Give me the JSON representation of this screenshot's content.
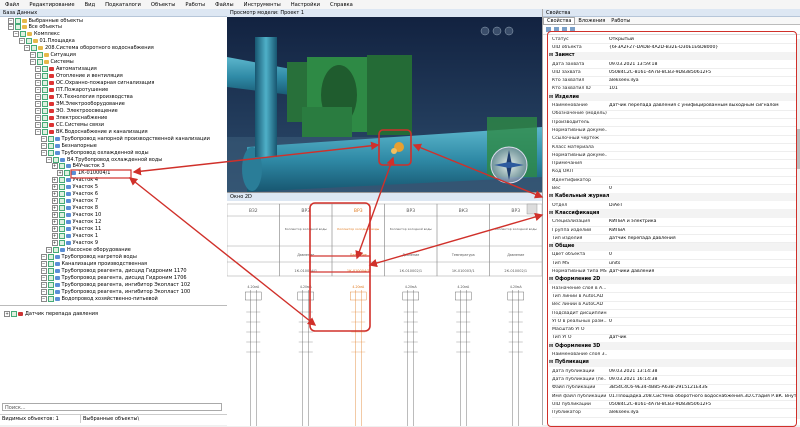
{
  "menu": [
    "Файл",
    "Редактирование",
    "Вид",
    "Подкаталоги",
    "Объекты",
    "Работы",
    "Файлы",
    "Инструменты",
    "Настройки",
    "Справка"
  ],
  "left_panel": {
    "title": "База Данных",
    "tree": [
      {
        "label": "Выбранные объекты",
        "level": 1
      },
      {
        "label": "Все объекты",
        "level": 1
      },
      {
        "label": "Комплекс",
        "level": 2
      },
      {
        "label": "01.Площадка",
        "level": 3
      },
      {
        "label": "208.Система оборотного водоснабжения",
        "level": 4
      },
      {
        "label": "Ситуация",
        "level": 5
      },
      {
        "label": "Системы",
        "level": 5
      },
      {
        "label": "Автоматизация",
        "level": 6
      },
      {
        "label": "Отопление и вентиляция",
        "level": 6
      },
      {
        "label": "ОС.Охранно-пожарная сигнализация",
        "level": 6
      },
      {
        "label": "ПТ.Пожаротушение",
        "level": 6
      },
      {
        "label": "ТХ.Технология производства",
        "level": 6
      },
      {
        "label": "ЭМ.Электрооборудование",
        "level": 6
      },
      {
        "label": "ЭО. Электроосвещение",
        "level": 6
      },
      {
        "label": "Электроснабжение",
        "level": 6
      },
      {
        "label": "СС.Системы связи",
        "level": 6
      },
      {
        "label": "ВК.Водоснабжение и канализация",
        "level": 6
      },
      {
        "label": "Трубопровод напорной производственной канализации",
        "level": 7
      },
      {
        "label": "Безнапорные",
        "level": 7
      },
      {
        "label": "Трубопровод охлажденной воды",
        "level": 7
      },
      {
        "label": "В4.Трубопровод охлажденной воды",
        "level": 8
      },
      {
        "label": "В4Участок 3",
        "level": 9
      },
      {
        "label": "1К-010004/1",
        "level": 10
      },
      {
        "label": "Участок 4",
        "level": 9
      },
      {
        "label": "Участок 5",
        "level": 9
      },
      {
        "label": "Участок 6",
        "level": 9
      },
      {
        "label": "Участок 7",
        "level": 9
      },
      {
        "label": "Участок 8",
        "level": 9
      },
      {
        "label": "Участок 10",
        "level": 9
      },
      {
        "label": "Участок 12",
        "level": 9
      },
      {
        "label": "Участок 11",
        "level": 9
      },
      {
        "label": "Участок 1",
        "level": 9
      },
      {
        "label": "Участок 9",
        "level": 9
      },
      {
        "label": "Насосное оборудование",
        "level": 8
      },
      {
        "label": "Трубопровод нагретой воды",
        "level": 7
      },
      {
        "label": "Канализация производственная",
        "level": 7
      },
      {
        "label": "Трубопровод реагента, дисцид Гидроним 1170",
        "level": 7
      },
      {
        "label": "Трубопровод реагента, дисцид Гидроним 1706",
        "level": 7
      },
      {
        "label": "Трубопровод реагента, ингибитор Экопласт 102",
        "level": 7
      },
      {
        "label": "Трубопровод реагента, ингибитор Экопласт 100",
        "level": 7
      },
      {
        "label": "Водопровод хозяйственно-питьевой",
        "level": 7
      }
    ],
    "bottom_item": "Датчик перепада давления",
    "search_label": "Поиск...",
    "status_left": "Видимых объектов: 1",
    "status_right": "Выбранные объекты\\"
  },
  "viewer": {
    "title": "Просмотр модели: Проект 1"
  },
  "window2d": {
    "title": "Окно 2D",
    "columns": [
      {
        "code": "ВЗ2",
        "desc": "",
        "type": "",
        "pos": "",
        "orange": false
      },
      {
        "code": "ВР3",
        "desc": "Коллектор холодной воды",
        "type": "Давление",
        "pos": "1К-010004/1",
        "orange": false
      },
      {
        "code": "ВР3",
        "desc": "Коллектор холодной воды",
        "type": "Давление",
        "pos": "1К-010004/1",
        "orange": true
      },
      {
        "code": "ВР3",
        "desc": "Коллектор холодной воды",
        "type": "Давление",
        "pos": "1К-010002/1",
        "orange": false
      },
      {
        "code": "ВК3",
        "desc": "",
        "type": "Температура",
        "pos": "1К-010003/1",
        "orange": false
      },
      {
        "code": "ВР3",
        "desc": "Коллектор холодной воды",
        "type": "Давление",
        "pos": "2К-010002/1",
        "orange": false
      }
    ],
    "signal": "4-20мА"
  },
  "properties": {
    "title": "Свойства",
    "tabs": [
      "Свойства",
      "Вложения",
      "Работы"
    ],
    "rows": [
      {
        "section": false,
        "k": "Статус",
        "v": "Открытый"
      },
      {
        "section": false,
        "k": "UID объекта",
        "v": "{6F3A2F27-DADB-4A2D-B32E-D30E1E6D8000}"
      },
      {
        "section": true,
        "k": "Заимст",
        "v": ""
      },
      {
        "section": false,
        "k": "Дата захвата",
        "v": "09.03.2021 13:59:18"
      },
      {
        "section": false,
        "k": "UID захвата",
        "v": "05084C2C-8161-4A7B-8CB3-9D83850612F5"
      },
      {
        "section": false,
        "k": "Кто захватил",
        "v": "alekseev.ilya"
      },
      {
        "section": false,
        "k": "Кто захватил ID",
        "v": "101"
      },
      {
        "section": true,
        "k": "Изделие",
        "v": ""
      },
      {
        "section": false,
        "k": "Наименование",
        "v": "Датчик перепада давления с унифицированным выходным сигналом"
      },
      {
        "section": false,
        "k": "Обозначение (модель)",
        "v": ""
      },
      {
        "section": false,
        "k": "Производитель",
        "v": ""
      },
      {
        "section": false,
        "k": "Нормативный докуме...",
        "v": ""
      },
      {
        "section": false,
        "k": "Ссылочный чертеж",
        "v": ""
      },
      {
        "section": false,
        "k": "Класс материала",
        "v": ""
      },
      {
        "section": false,
        "k": "Нормативный докуме...",
        "v": ""
      },
      {
        "section": false,
        "k": "Примечания",
        "v": ""
      },
      {
        "section": false,
        "k": "Код ОКП",
        "v": ""
      },
      {
        "section": false,
        "k": "Идентификатор",
        "v": ""
      },
      {
        "section": false,
        "k": "Вес",
        "v": "0"
      },
      {
        "section": true,
        "k": "Кабельный журнал",
        "v": ""
      },
      {
        "section": false,
        "k": "Отдел",
        "v": "DiAeT"
      },
      {
        "section": true,
        "k": "Классификация",
        "v": ""
      },
      {
        "section": false,
        "k": "Специализация",
        "v": "КИПиА и электрика"
      },
      {
        "section": false,
        "k": "Группа изделий",
        "v": "КИПиА"
      },
      {
        "section": false,
        "k": "Тип изделия",
        "v": "датчик перепада давления"
      },
      {
        "section": true,
        "k": "Общие",
        "v": ""
      },
      {
        "section": false,
        "k": "Цвет объекта",
        "v": "0"
      },
      {
        "section": false,
        "k": "Тип MS",
        "v": "units"
      },
      {
        "section": false,
        "k": "Нормативный типа MS",
        "v": "Датчики давления"
      },
      {
        "section": true,
        "k": "Оформление 2D",
        "v": ""
      },
      {
        "section": false,
        "k": "Назначение слоя в A...",
        "v": ""
      },
      {
        "section": false,
        "k": "Тип линии в AutoCAD",
        "v": ""
      },
      {
        "section": false,
        "k": "Вес линии в AutoCAD",
        "v": ""
      },
      {
        "section": false,
        "k": "Подсвадит дисциплины",
        "v": ""
      },
      {
        "section": false,
        "k": "УГО в реальных разм...",
        "v": "0"
      },
      {
        "section": false,
        "k": "Масштаб УГО",
        "v": ""
      },
      {
        "section": false,
        "k": "Тип УГО",
        "v": "Датчик"
      },
      {
        "section": true,
        "k": "Оформление 3D",
        "v": ""
      },
      {
        "section": false,
        "k": "Наименование слоя 3...",
        "v": ""
      },
      {
        "section": true,
        "k": "Публикация",
        "v": ""
      },
      {
        "section": false,
        "k": "Дата публикации",
        "v": "09.03.2021 13:14:38"
      },
      {
        "section": false,
        "k": "Дата публикации (пе...",
        "v": "09.03.2021 16:14:38"
      },
      {
        "section": false,
        "k": "Файл публикации",
        "v": "3B54C4C6-9E34-4B85-A63B-2915121E43S"
      },
      {
        "section": false,
        "k": "Имя файл публикации",
        "v": "01.Площадка.208.Система оборотного водоснабжения.3D.Стадия Р.ВК. Внутренние водопровод и канализация.Водоснабжение.ВК_В4.dwg.dwc"
      },
      {
        "section": false,
        "k": "UID публикации",
        "v": "05084C2C-8161-4A7B-8CB3-9D83850612F5"
      },
      {
        "section": false,
        "k": "Публикатор",
        "v": "alekseev.ilya"
      }
    ]
  },
  "colors": {
    "annotation": "#d0302a",
    "orange": "#e07a20",
    "panel_title": "#dde7f3"
  }
}
